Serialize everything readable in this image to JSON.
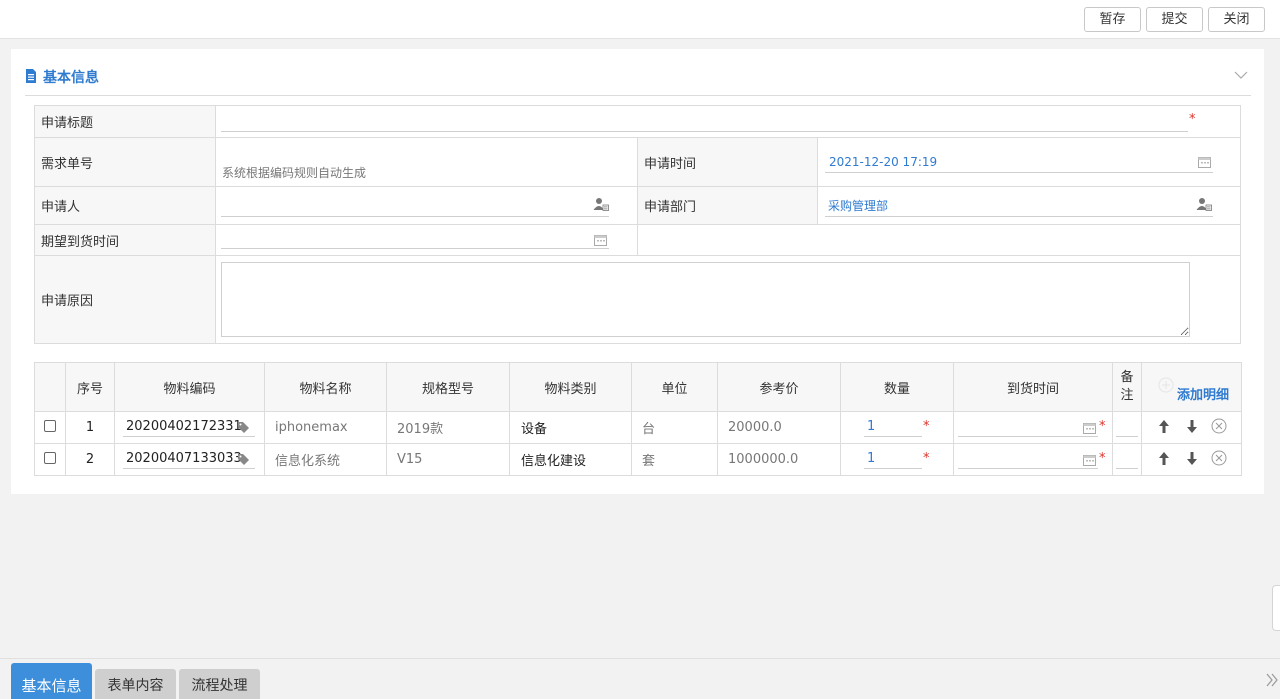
{
  "toolbar": {
    "save_label": "暂存",
    "submit_label": "提交",
    "close_label": "关闭"
  },
  "section": {
    "title": "基本信息"
  },
  "form": {
    "title_label": "申请标题",
    "title_value": "",
    "req_no_label": "需求单号",
    "req_no_placeholder": "系统根据编码规则自动生成",
    "apply_time_label": "申请时间",
    "apply_time_value": "2021-12-20 17:19",
    "applicant_label": "申请人",
    "applicant_value": "",
    "dept_label": "申请部门",
    "dept_value": "采购管理部",
    "expect_label": "期望到货时间",
    "expect_value": "",
    "reason_label": "申请原因",
    "reason_value": ""
  },
  "grid": {
    "headers": [
      "序号",
      "物料编码",
      "物料名称",
      "规格型号",
      "物料类别",
      "单位",
      "参考价",
      "数量",
      "到货时间",
      "备注"
    ],
    "add_label": "添加明细",
    "rows": [
      {
        "seq": "1",
        "code": "20200402172331",
        "name": "iphonemax",
        "spec": "2019款",
        "category": "设备",
        "unit": "台",
        "price": "20000.0",
        "qty": "1"
      },
      {
        "seq": "2",
        "code": "20200407133033",
        "name": "信息化系统",
        "spec": "V15",
        "category": "信息化建设",
        "unit": "套",
        "price": "1000000.0",
        "qty": "1"
      }
    ]
  },
  "tabs": {
    "basic": "基本信息",
    "form_content": "表单内容",
    "process": "流程处理"
  },
  "icons": [
    "doc-icon",
    "chevron-down-icon",
    "calendar-icon",
    "user-select-icon",
    "tag-icon",
    "arrow-up-icon",
    "arrow-down-icon",
    "remove-icon",
    "add-icon",
    "expand-icon"
  ],
  "colors": {
    "accent": "#2f7bd0",
    "required": "#e0312a",
    "active_tab": "#3d8fdb"
  }
}
